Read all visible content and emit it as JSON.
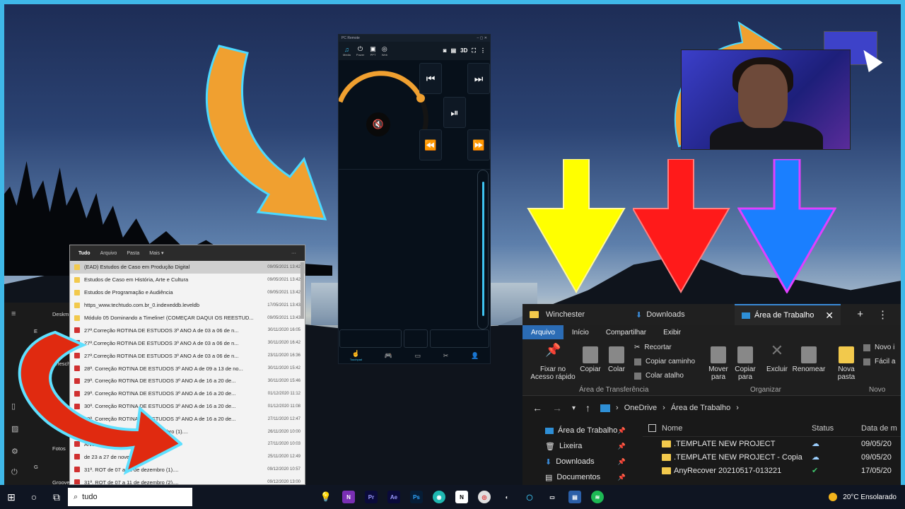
{
  "phone_app": {
    "window_title": "PC Remote",
    "tools": [
      "Media",
      "Power",
      "PPT",
      "Web"
    ],
    "right_label": "3D",
    "nav_active": "Touchpad"
  },
  "search": {
    "tabs": [
      "Tudo",
      "Arquivo",
      "Pasta",
      "Mais"
    ],
    "rows": [
      {
        "name": "(EAD) Estudos de Caso em Produção Digital",
        "date": "09/05/2021 13:42",
        "icon": "folder-icon"
      },
      {
        "name": "Estudos de Caso em História, Arte e Cultura",
        "date": "09/05/2021 13:42",
        "icon": "folder-icon"
      },
      {
        "name": "Estudos de Programação e Audiência",
        "date": "09/05/2021 13:42",
        "icon": "folder-icon"
      },
      {
        "name": "https_www.techtudo.com.br_0.indexeddb.leveldb",
        "date": "17/05/2021 13:43",
        "icon": "folder-icon"
      },
      {
        "name": "Módulo 05 Dominando a Timeline! (COMEÇAR DAQUI OS REESTUD...",
        "date": "09/05/2021 13:43",
        "icon": "folder-icon"
      },
      {
        "name": "27ª.Correção          ROTINA DE ESTUDOS 3º ANO A      de 03 a 06 de n...",
        "date": "30/11/2020 16:05",
        "icon": "pdf-icon"
      },
      {
        "name": "27ª.Correção          ROTINA DE ESTUDOS 3º ANO A      de 03 a 06 de n...",
        "date": "30/11/2020 16:42",
        "icon": "pdf-icon"
      },
      {
        "name": "27ª.Correção          ROTINA DE ESTUDOS 3º ANO A      de 03 a 06 de n...",
        "date": "23/11/2020 16:36",
        "icon": "pdf-icon"
      },
      {
        "name": "28ª. Correção      ROTINA DE ESTUDOS 3º ANO A     de 09 a 13 de no...",
        "date": "30/11/2020 15:42",
        "icon": "pdf-icon"
      },
      {
        "name": "29ª. Correção           ROTINA DE ESTUDOS 3º ANO A      de 16 a 20 de...",
        "date": "30/11/2020 15:46",
        "icon": "pdf-icon"
      },
      {
        "name": "29ª. Correção           ROTINA DE ESTUDOS 3º ANO A      de 16 a 20 de...",
        "date": "01/12/2020 11:12",
        "icon": "pdf-icon"
      },
      {
        "name": "30ª. Correção           ROTINA DE ESTUDOS 3º ANO A      de 16 a 20 de...",
        "date": "01/12/2020 11:08",
        "icon": "pdf-icon"
      },
      {
        "name": "30ª. Correção           ROTINA DE ESTUDOS 3º ANO A      de 16 a 20 de...",
        "date": "27/11/2020 12:47",
        "icon": "pdf-icon"
      },
      {
        "name": "                          OS 3º ANO A      de 23 a 27 de novembro (1)....",
        "date": "26/11/2020 10:00",
        "icon": "pdf-icon"
      },
      {
        "name": "                          ANO A      de 23 a 27 de novembro (2)....",
        "date": "27/11/2020 10:03",
        "icon": "pdf-icon"
      },
      {
        "name": "                          de 23 a 27 de novembro.pdf",
        "date": "25/11/2020 12:49",
        "icon": "pdf-icon"
      },
      {
        "name": "31ª. ROT                      de 07 a 11 de dezembro (1)....",
        "date": "09/12/2020 10:57",
        "icon": "pdf-icon"
      },
      {
        "name": "31ª. ROT                      de 07 a 11 de dezembro (2)....",
        "date": "09/12/2020 13:00",
        "icon": "pdf-icon"
      }
    ]
  },
  "start": {
    "items": [
      "Deskm",
      "E",
      "Erfesch",
      "Fotos",
      "G",
      "Groove"
    ]
  },
  "explorer": {
    "tabs": [
      "Winchester",
      "Downloads",
      "Área de Trabalho"
    ],
    "menu": [
      "Arquivo",
      "Início",
      "Compartilhar",
      "Exibir"
    ],
    "ribbon": {
      "pin": "Fixar no Acesso rápido",
      "copy": "Copiar",
      "paste": "Colar",
      "cut": "Recortar",
      "copy_path": "Copiar caminho",
      "paste_shortcut": "Colar atalho",
      "group_clipboard": "Área de Transferência",
      "move": "Mover para",
      "copy_to": "Copiar para",
      "delete": "Excluir",
      "rename": "Renomear",
      "group_organize": "Organizar",
      "new_folder": "Nova pasta",
      "new_item": "Novo i",
      "easy": "Fácil a",
      "group_new": "Novo"
    },
    "breadcrumb": [
      "OneDrive",
      "Área de Trabalho"
    ],
    "nav": [
      "Área de Trabalho",
      "Lixeira",
      "Downloads",
      "Documentos"
    ],
    "columns": [
      "Nome",
      "Status",
      "Data de m"
    ],
    "files": [
      {
        "name": ".TEMPLATE NEW PROJECT",
        "date": "09/05/20"
      },
      {
        "name": ".TEMPLATE NEW PROJECT - Copia",
        "date": "09/05/20"
      },
      {
        "name": "AnyRecover 20210517-013221",
        "date": "17/05/20"
      }
    ]
  },
  "taskbar": {
    "search_text": "tudo",
    "weather": "20°C  Ensolarado"
  },
  "colors": {
    "accent": "#3ec3f0",
    "orange": "#f0a030",
    "yellow": "#ffff00",
    "red": "#ff1a1a",
    "blue": "#1a7fff"
  }
}
